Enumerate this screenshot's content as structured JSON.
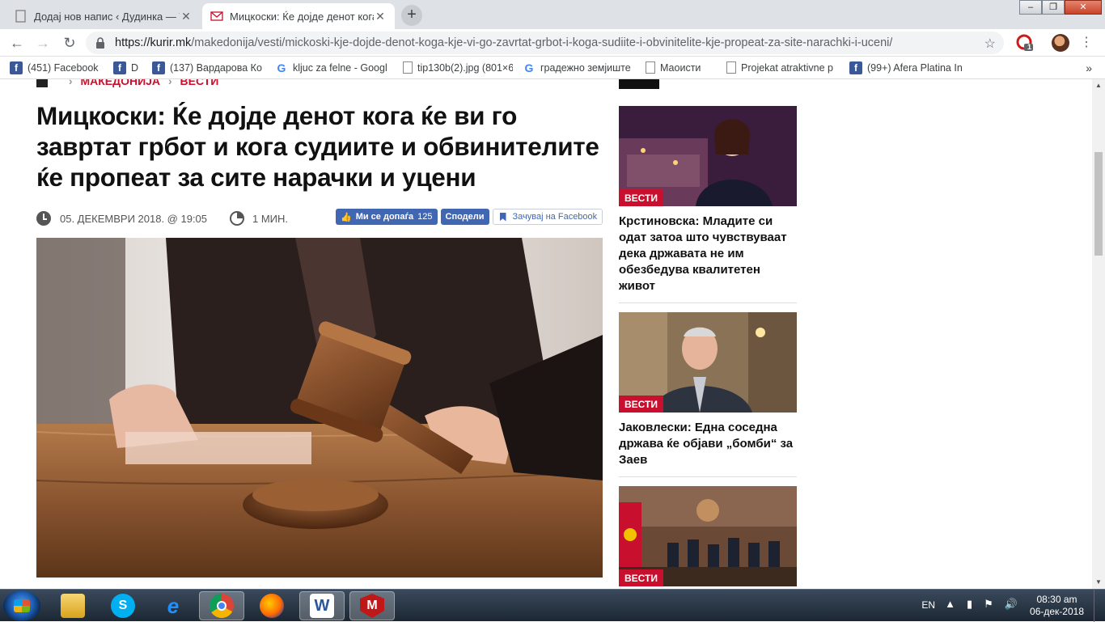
{
  "browser": {
    "tabs": [
      {
        "title": "Додај нов напис ‹ Дудинка — W",
        "active": false
      },
      {
        "title": "Мицкоски: Ќе дојде денот кога",
        "active": true
      }
    ],
    "new_tab_label": "+",
    "url_host": "https://kurir.mk",
    "url_path": "/makedonija/vesti/mickoski-kje-dojde-denot-koga-kje-vi-go-zavrtat-grbot-i-koga-sudiite-i-obvinitelite-kje-propeat-za-site-narachki-i-uceni/",
    "extension_badge": "1",
    "bookmarks": [
      {
        "label": "(451) Facebook",
        "icon": "facebook-icon"
      },
      {
        "label": "D",
        "icon": "facebook-icon"
      },
      {
        "label": "(137) Вардарова Ко",
        "icon": "facebook-icon"
      },
      {
        "label": "kljuc za felne - Googl",
        "icon": "google-icon"
      },
      {
        "label": "tip130b(2).jpg (801×6",
        "icon": "document-icon"
      },
      {
        "label": "градежно земјиште",
        "icon": "google-icon"
      },
      {
        "label": "Маоисти",
        "icon": "document-icon"
      },
      {
        "label": "Projekat atraktivne p",
        "icon": "document-icon"
      },
      {
        "label": "(99+) Afera Platina In",
        "icon": "facebook-icon"
      }
    ],
    "bookmarks_more": "»"
  },
  "article": {
    "breadcrumb": [
      "МАКЕДОНИЈА",
      "ВЕСТИ"
    ],
    "headline": "Мицкоски: Ќе дојде денот кога ќе ви го завртат грбот и кога судиите и обвинителите ќе пропеат за сите нарачки и уцени",
    "date": "05. ДЕКЕМВРИ 2018. @ 19:05",
    "read_time": "1 МИН.",
    "fb_like_label": "Ми се допаѓа",
    "fb_like_count": "125",
    "fb_share_label": "Сподели",
    "fb_save_label": "Зачувај на Facebook"
  },
  "sidebar": {
    "cards": [
      {
        "tag": "ВЕСТИ",
        "title": "Крстиновска: Младите си одат затоа што чувствуваат дека државата не им обезбедува квалитетен живот"
      },
      {
        "tag": "ВЕСТИ",
        "title": "Јаковлески: Една соседна држава ќе објави „бомби“ за Заев"
      },
      {
        "tag": "ВЕСТИ",
        "title": ""
      }
    ]
  },
  "taskbar": {
    "apps": [
      "Explorer",
      "Skype",
      "Internet Explorer",
      "Chrome",
      "Firefox",
      "Word",
      "McAfee"
    ],
    "language": "EN",
    "time": "08:30 am",
    "date": "06-дек-2018"
  },
  "colors": {
    "accent_red": "#c8102e",
    "facebook_blue": "#4267b2",
    "text_dark": "#111111"
  }
}
